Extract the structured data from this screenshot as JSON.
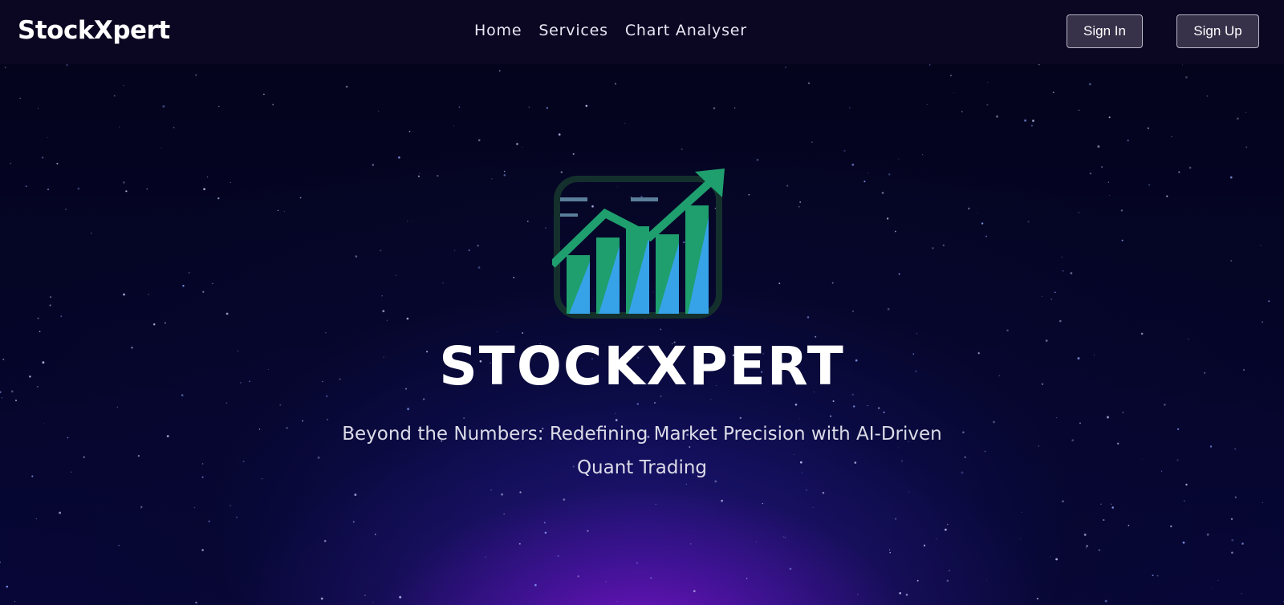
{
  "navbar": {
    "brand": "StockXpert",
    "links": [
      {
        "label": "Home"
      },
      {
        "label": "Services"
      },
      {
        "label": "Chart Analyser"
      }
    ],
    "sign_in_label": "Sign In",
    "sign_up_label": "Sign Up"
  },
  "hero": {
    "logo_icon": "rising-bar-chart-icon",
    "title": "STOCKXPERT",
    "subtitle": "Beyond the Numbers: Redefining Market Precision with AI-Driven Quant Trading"
  },
  "colors": {
    "accent_green": "#1f9e6e",
    "accent_blue": "#36a3e8",
    "nav_bg": "#0b0722",
    "button_bg": "#37324a"
  }
}
